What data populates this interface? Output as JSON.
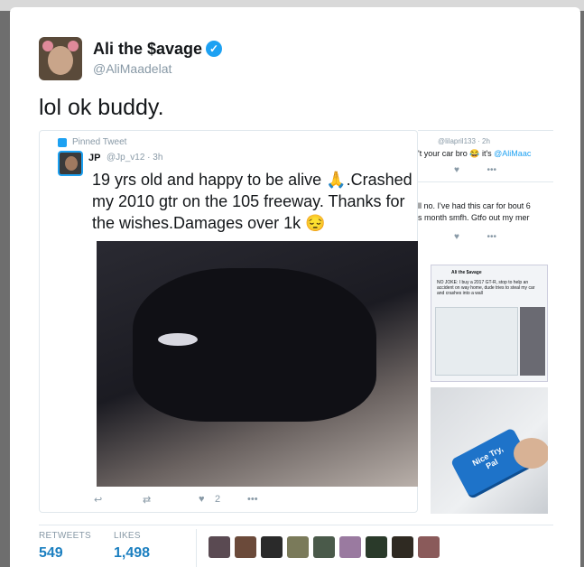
{
  "tweet": {
    "display_name": "Ali the $avage",
    "handle": "@AliMaadelat",
    "text": "lol ok buddy.",
    "verified_icon": "verified-badge-icon",
    "retweets_label": "RETWEETS",
    "retweets": "549",
    "likes_label": "LIKES",
    "likes": "1,498",
    "liker_colors": [
      "#5a4a52",
      "#6b4a3a",
      "#2a2a2a",
      "#7a7a5a",
      "#4a5a4a",
      "#9a7aa0",
      "#2a3a2a",
      "#2f2a22",
      "#8a5a5a"
    ]
  },
  "quoted": {
    "pinned_label": "Pinned Tweet",
    "name": "JP",
    "handle": "@Jp_v12 · 3h",
    "text": "19 yrs old and happy to be alive 🙏.Crashed my 2010 gtr on the 105 freeway. Thanks for the wishes.Damages over 1k 😔",
    "like_count": "2",
    "reply_icon": "↩",
    "retweet_icon": "⇄",
    "like_icon": "♥",
    "more_icon": "•••"
  },
  "side": {
    "handle": "@lilapril133 · 2h",
    "line1_a": "'t your car bro 😂 it's ",
    "line1_mention": "@AliMaac",
    "line2": "ll no. I've had this car for bout 6",
    "line3": "s month smfh. Gtfo out my mer",
    "shot_header": "Ali the $avage",
    "shot_text": "NO JOKE: I buy a 2017 GT-R, stop to help an accident on way home, dude tries to steal my car and crashes into a wall",
    "key_text_1": "Nice Try,",
    "key_text_2": "Pal"
  }
}
